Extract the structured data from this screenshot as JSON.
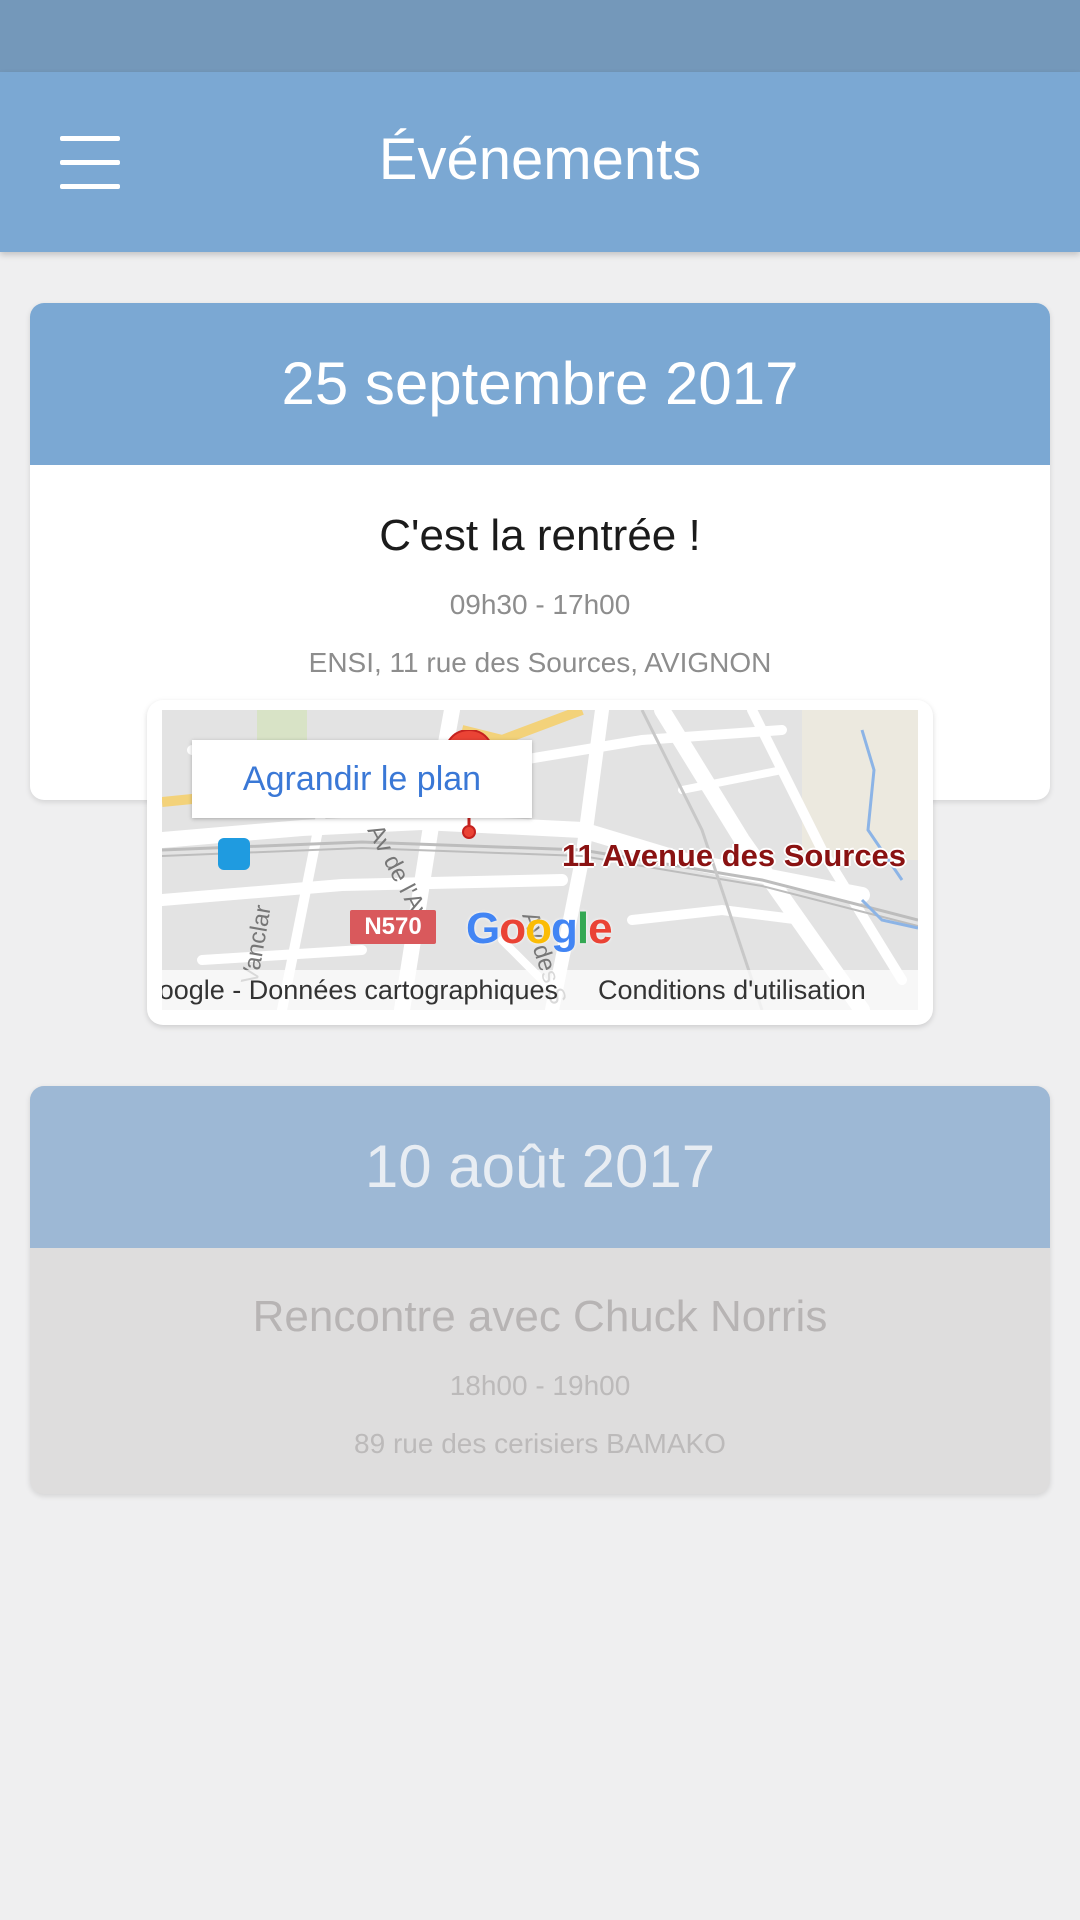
{
  "app_bar": {
    "title": "Événements",
    "menu_icon": "hamburger-menu-icon"
  },
  "events": [
    {
      "date": "25 septembre 2017",
      "title": "C'est la rentrée !",
      "time": "09h30 - 17h00",
      "place": "ENSI, 11 rue des Sources, AVIGNON",
      "map": {
        "enlarge_label": "Agrandir le plan",
        "address_label": "11 Avenue des Sources",
        "road_label": "N570",
        "street_label_1": "Av de l'Av",
        "street_label_2": "Av des S",
        "street_label_3": "Vanclar",
        "map_data_text": "Google - Données cartographiques",
        "terms_text": "Conditions d'utilisation",
        "google_logo": [
          "G",
          "o",
          "o",
          "g",
          "l",
          "e"
        ],
        "pin_icon": "map-pin-icon",
        "transit_icon": "train-station-icon"
      }
    },
    {
      "date": "10 août 2017",
      "title": "Rencontre avec Chuck Norris",
      "time": "18h00 - 19h00",
      "place": "89 rue des cerisiers BAMAKO"
    }
  ],
  "colors": {
    "app_bar": "#7ba8d3",
    "status_bar": "#7498ba",
    "past_event_header": "#9db8d5",
    "past_event_body": "#dedddd",
    "background": "#efeff0",
    "link": "#3a78d6",
    "pin": "#ea4335"
  }
}
